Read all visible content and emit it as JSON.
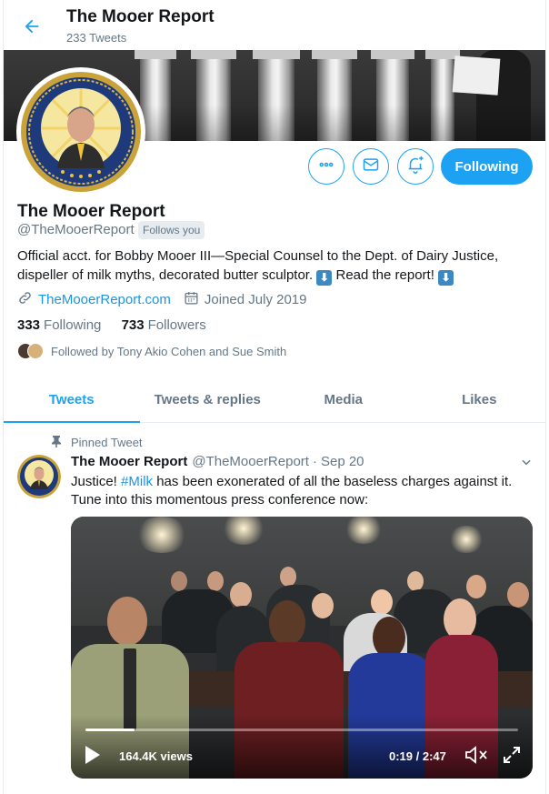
{
  "header": {
    "title": "The Mooer Report",
    "tweet_count": "233 Tweets"
  },
  "colors": {
    "accent": "#1da1f2",
    "link": "#1b95e0",
    "muted": "#657786"
  },
  "profile": {
    "name": "The Mooer Report",
    "handle": "@TheMooerReport",
    "follows_you": "Follows you",
    "bio_part1": "Official acct. for Bobby Mooer III—Special Counsel to the Dept. of Dairy Justice, dispeller of milk myths, decorated butter sculptor. ",
    "bio_part2": " Read  the report! ",
    "bio_emoji": "⬇",
    "website": "TheMooerReport.com",
    "joined": "Joined July 2019",
    "following_count": "333",
    "following_label": "Following",
    "followers_count": "733",
    "followers_label": "Followers",
    "followed_by": "Followed by Tony Akio Cohen and Sue Smith"
  },
  "actions": {
    "more_icon": "more-icon",
    "message_icon": "mail-icon",
    "notify_icon": "bell-plus-icon",
    "following_button": "Following"
  },
  "tabs": [
    {
      "label": "Tweets",
      "active": true
    },
    {
      "label": "Tweets & replies",
      "active": false
    },
    {
      "label": "Media",
      "active": false
    },
    {
      "label": "Likes",
      "active": false
    }
  ],
  "tweet": {
    "pinned_label": "Pinned Tweet",
    "author": "The Mooer Report",
    "handle": "@TheMooerReport",
    "separator": "·",
    "date": "Sep 20",
    "text_before": "Justice! ",
    "hashtag": "#Milk",
    "text_after": " has been exonerated of all the baseless charges against it. Tune into this momentous press conference now:",
    "video": {
      "views": "164.4K views",
      "time": "0:19 / 2:47",
      "progress_fraction": 0.114
    }
  }
}
